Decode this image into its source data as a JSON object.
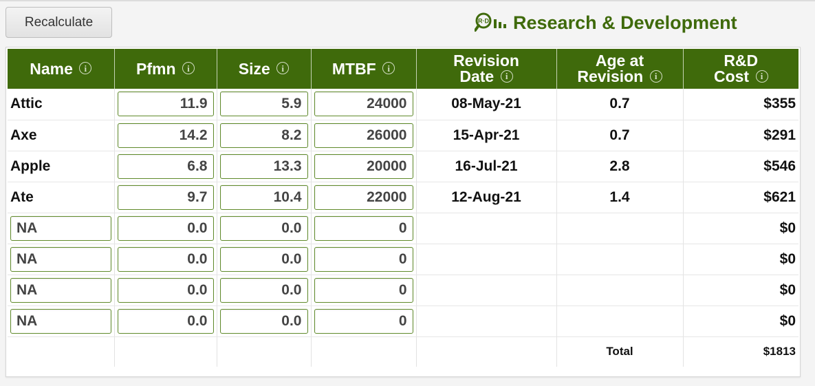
{
  "toolbar": {
    "recalculate_label": "Recalculate"
  },
  "brand": {
    "title": "Research & Development",
    "icon": "rd-magnifier-bars-icon",
    "color": "#3f6a0b"
  },
  "table": {
    "columns": [
      {
        "label": "Name"
      },
      {
        "label": "Pfmn"
      },
      {
        "label": "Size"
      },
      {
        "label": "MTBF"
      },
      {
        "label_line1": "Revision",
        "label_line2": "Date"
      },
      {
        "label_line1": "Age at",
        "label_line2": "Revision"
      },
      {
        "label_line1": "R&D",
        "label_line2": "Cost"
      }
    ],
    "info_glyph": "i",
    "rows": [
      {
        "name": "Attic",
        "pfmn": "11.9",
        "size": "5.9",
        "mtbf": "24000",
        "revision_date": "08-May-21",
        "age": "0.7",
        "cost": "$355"
      },
      {
        "name": "Axe",
        "pfmn": "14.2",
        "size": "8.2",
        "mtbf": "26000",
        "revision_date": "15-Apr-21",
        "age": "0.7",
        "cost": "$291"
      },
      {
        "name": "Apple",
        "pfmn": "6.8",
        "size": "13.3",
        "mtbf": "20000",
        "revision_date": "16-Jul-21",
        "age": "2.8",
        "cost": "$546"
      },
      {
        "name": "Ate",
        "pfmn": "9.7",
        "size": "10.4",
        "mtbf": "22000",
        "revision_date": "12-Aug-21",
        "age": "1.4",
        "cost": "$621"
      },
      {
        "name": "NA",
        "pfmn": "0.0",
        "size": "0.0",
        "mtbf": "0",
        "revision_date": "",
        "age": "",
        "cost": "$0"
      },
      {
        "name": "NA",
        "pfmn": "0.0",
        "size": "0.0",
        "mtbf": "0",
        "revision_date": "",
        "age": "",
        "cost": "$0"
      },
      {
        "name": "NA",
        "pfmn": "0.0",
        "size": "0.0",
        "mtbf": "0",
        "revision_date": "",
        "age": "",
        "cost": "$0"
      },
      {
        "name": "NA",
        "pfmn": "0.0",
        "size": "0.0",
        "mtbf": "0",
        "revision_date": "",
        "age": "",
        "cost": "$0"
      }
    ],
    "total_label": "Total",
    "total_value": "$1813"
  }
}
